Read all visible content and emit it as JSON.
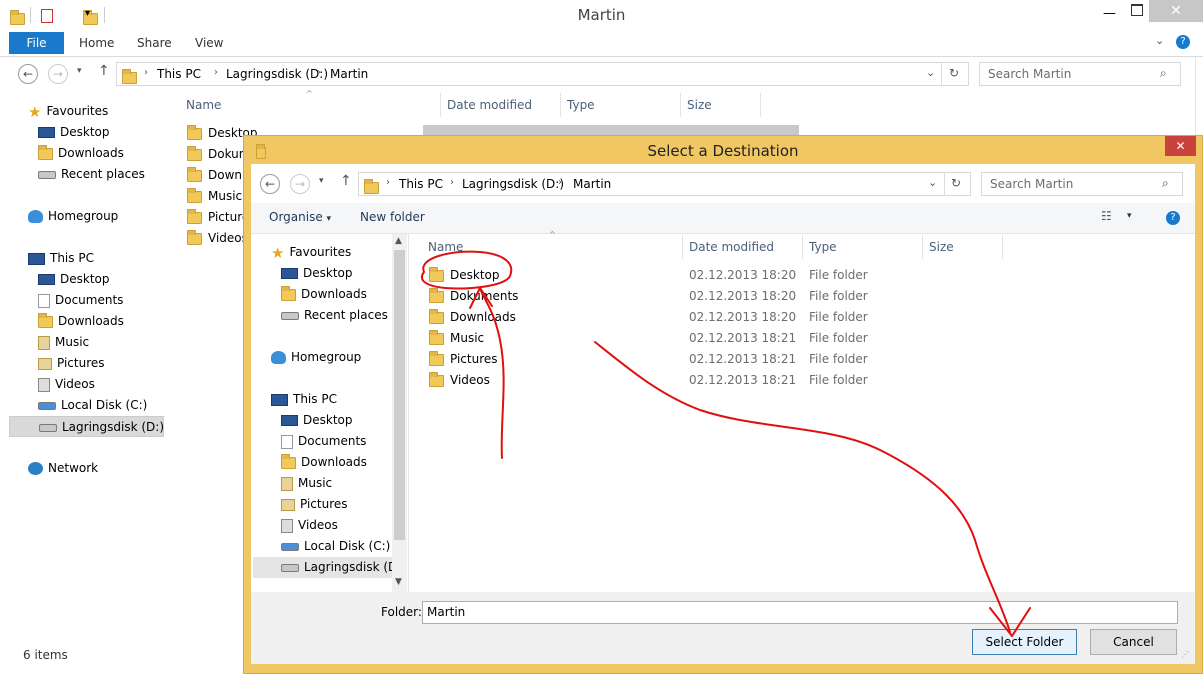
{
  "main_window": {
    "title": "Martin",
    "ribbon_tabs": [
      "File",
      "Home",
      "Share",
      "View"
    ],
    "breadcrumb": [
      "This PC",
      "Lagringsdisk (D:)",
      "Martin"
    ],
    "search_placeholder": "Search Martin",
    "columns": [
      "Name",
      "Date modified",
      "Type",
      "Size"
    ],
    "files": [
      "Desktop",
      "Dokum",
      "Downl",
      "Music",
      "Picture",
      "Videos"
    ],
    "nav": {
      "favourites_label": "Favourites",
      "favourites": [
        "Desktop",
        "Downloads",
        "Recent places"
      ],
      "homegroup": "Homegroup",
      "thispc_label": "This PC",
      "thispc": [
        "Desktop",
        "Documents",
        "Downloads",
        "Music",
        "Pictures",
        "Videos",
        "Local Disk (C:)",
        "Lagringsdisk (D:)"
      ],
      "network": "Network"
    },
    "status": "6 items"
  },
  "dialog": {
    "title": "Select a Destination",
    "breadcrumb": [
      "This PC",
      "Lagringsdisk (D:)",
      "Martin"
    ],
    "search_placeholder": "Search Martin",
    "organise": "Organise",
    "new_folder": "New folder",
    "columns": [
      "Name",
      "Date modified",
      "Type",
      "Size"
    ],
    "files": [
      {
        "name": "Desktop",
        "date": "02.12.2013 18:20",
        "type": "File folder"
      },
      {
        "name": "Dokuments",
        "date": "02.12.2013 18:20",
        "type": "File folder"
      },
      {
        "name": "Downloads",
        "date": "02.12.2013 18:20",
        "type": "File folder"
      },
      {
        "name": "Music",
        "date": "02.12.2013 18:21",
        "type": "File folder"
      },
      {
        "name": "Pictures",
        "date": "02.12.2013 18:21",
        "type": "File folder"
      },
      {
        "name": "Videos",
        "date": "02.12.2013 18:21",
        "type": "File folder"
      }
    ],
    "nav": {
      "favourites_label": "Favourites",
      "favourites": [
        "Desktop",
        "Downloads",
        "Recent places"
      ],
      "homegroup": "Homegroup",
      "thispc_label": "This PC",
      "thispc": [
        "Desktop",
        "Documents",
        "Downloads",
        "Music",
        "Pictures",
        "Videos",
        "Local Disk (C:)",
        "Lagringsdisk (D:)"
      ]
    },
    "folder_label": "Folder:",
    "folder_value": "Martin",
    "select_button": "Select Folder",
    "cancel_button": "Cancel"
  },
  "annotation_color": "#e01010",
  "accent_color": "#1979ca"
}
